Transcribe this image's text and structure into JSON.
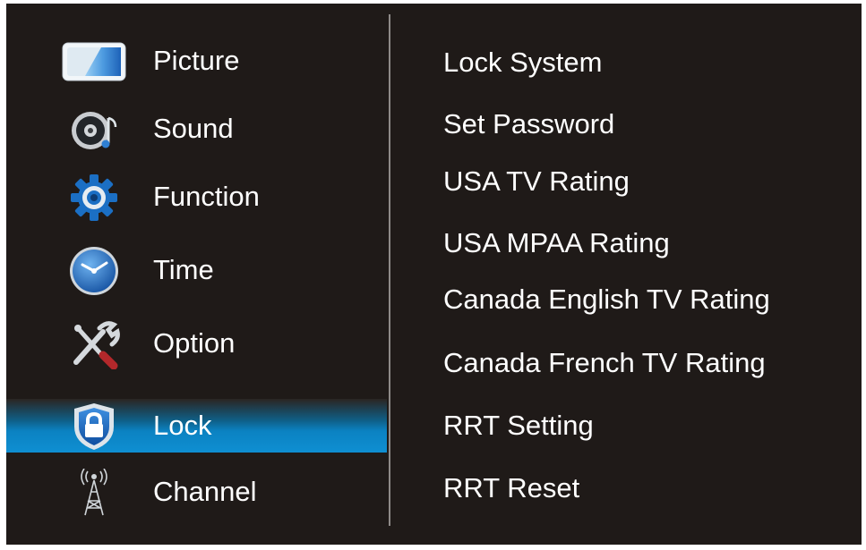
{
  "menu": {
    "items": [
      {
        "label": "Picture",
        "icon": "picture-icon"
      },
      {
        "label": "Sound",
        "icon": "speaker-icon"
      },
      {
        "label": "Function",
        "icon": "gear-icon"
      },
      {
        "label": "Time",
        "icon": "clock-icon"
      },
      {
        "label": "Option",
        "icon": "tools-icon"
      },
      {
        "label": "Lock",
        "icon": "lock-icon",
        "selected": true
      },
      {
        "label": "Channel",
        "icon": "antenna-icon"
      }
    ]
  },
  "submenu": {
    "items": [
      "Lock System",
      "Set Password",
      "USA TV Rating",
      "USA MPAA Rating",
      "Canada English TV Rating",
      "Canada French TV Rating",
      "RRT Setting",
      "RRT Reset"
    ]
  },
  "colors": {
    "background": "#1f1a18",
    "selection": "#0b82c2",
    "text": "#ffffff"
  }
}
